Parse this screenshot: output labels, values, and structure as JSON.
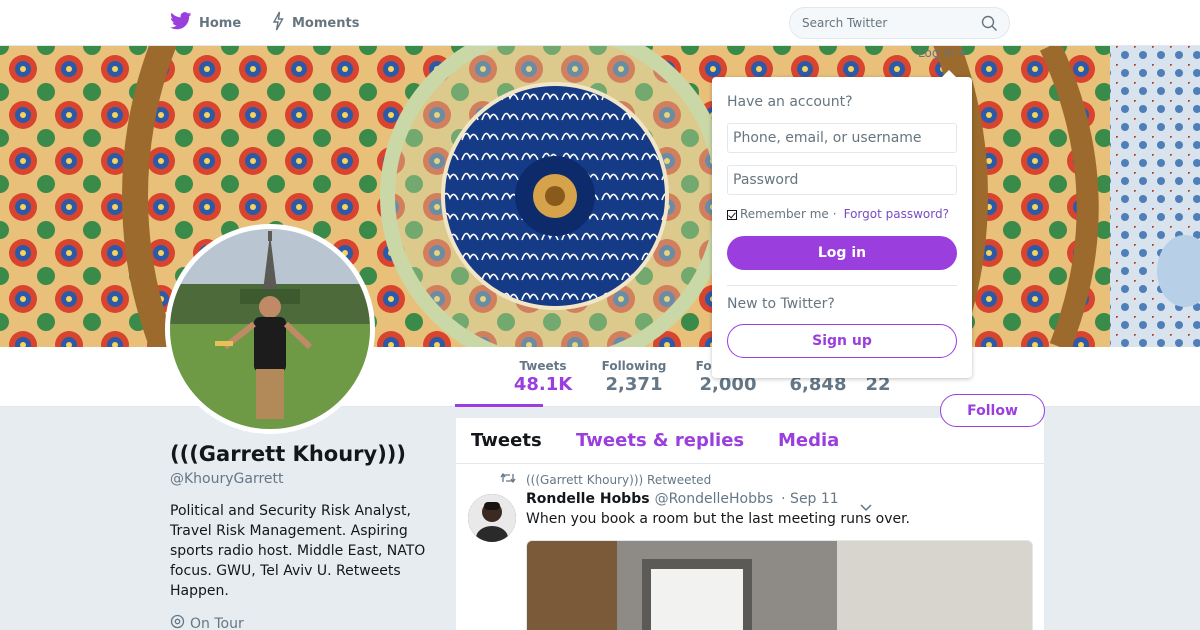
{
  "nav": {
    "home_label": "Home",
    "moments_label": "Moments",
    "search_placeholder": "Search Twitter",
    "login_label": "Log in"
  },
  "login_dropdown": {
    "have_account": "Have an account?",
    "username_placeholder": "Phone, email, or username",
    "password_placeholder": "Password",
    "remember_me": "Remember me",
    "separator": "·",
    "forgot_password": "Forgot password?",
    "login_button": "Log in",
    "new_to_twitter": "New to Twitter?",
    "signup_button": "Sign up"
  },
  "stats": [
    {
      "label": "Tweets",
      "value": "48.1K"
    },
    {
      "label": "Following",
      "value": "2,371"
    },
    {
      "label": "Followers",
      "value": "2,000"
    },
    {
      "label": "",
      "value": "6,848"
    },
    {
      "label": "",
      "value": "22"
    }
  ],
  "follow_button": "Follow",
  "profile": {
    "name": "(((Garrett Khoury)))",
    "handle": "@KhouryGarrett",
    "bio": "Political and Security Risk Analyst, Travel Risk Management. Aspiring sports radio host. Middle East, NATO focus. GWU, Tel Aviv U. Retweets Happen.",
    "location": "On Tour"
  },
  "timeline": {
    "tabs": [
      "Tweets",
      "Tweets & replies",
      "Media"
    ],
    "retweet_context": "(((Garrett Khoury))) Retweeted",
    "tweet": {
      "name": "Rondelle Hobbs",
      "handle": "@RondelleHobbs",
      "time": "· Sep 11",
      "text": "When you book a room but the last meeting runs over."
    }
  },
  "colors": {
    "accent": "#9b3ede",
    "link": "#794bc4",
    "muted": "#657786",
    "background": "#e6ecf0"
  },
  "icons": {
    "home": "twitter-bird-icon",
    "moments": "lightning-icon",
    "search": "search-icon",
    "location": "location-pin-icon",
    "retweet": "retweet-icon",
    "caret": "chevron-down-icon"
  }
}
